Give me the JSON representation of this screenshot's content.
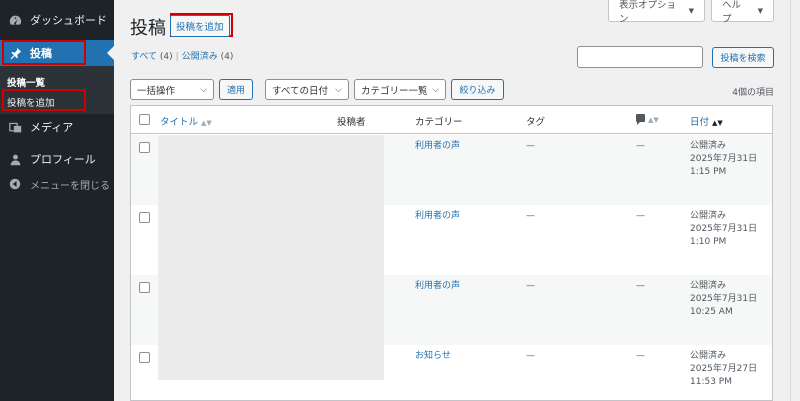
{
  "sidebar": {
    "dashboard": "ダッシュボード",
    "posts": "投稿",
    "posts_list": "投稿一覧",
    "add_post": "投稿を追加",
    "media": "メディア",
    "profile": "プロフィール",
    "collapse": "メニューを閉じる"
  },
  "header": {
    "title": "投稿",
    "add_new": "投稿を追加",
    "screen_options": "表示オプション",
    "help": "ヘルプ"
  },
  "filters": {
    "all": "すべて",
    "all_count": "(4)",
    "published": "公開済み",
    "published_count": "(4)",
    "search_button": "投稿を検索",
    "bulk_action": "一括操作",
    "apply": "適用",
    "all_dates": "すべての日付",
    "category": "カテゴリー一覧",
    "filter": "絞り込み",
    "item_count": "4個の項目"
  },
  "table": {
    "columns": {
      "title": "タイトル",
      "author": "投稿者",
      "category": "カテゴリー",
      "tags": "タグ",
      "date": "日付"
    },
    "rows": [
      {
        "category": "利用者の声",
        "tags": "—",
        "comments": "—",
        "status": "公開済み",
        "date": "2025年7月31日",
        "time": "1:15 PM"
      },
      {
        "category": "利用者の声",
        "tags": "—",
        "comments": "—",
        "status": "公開済み",
        "date": "2025年7月31日",
        "time": "1:10 PM"
      },
      {
        "category": "利用者の声",
        "tags": "—",
        "comments": "—",
        "status": "公開済み",
        "date": "2025年7月31日",
        "time": "10:25 AM"
      },
      {
        "category": "お知らせ",
        "tags": "—",
        "comments": "—",
        "status": "公開済み",
        "date": "2025年7月27日",
        "time": "11:53 PM"
      }
    ]
  },
  "colors": {
    "sidebar_bg": "#1d2327",
    "accent": "#2271b1",
    "highlight_box": "#d00000"
  }
}
